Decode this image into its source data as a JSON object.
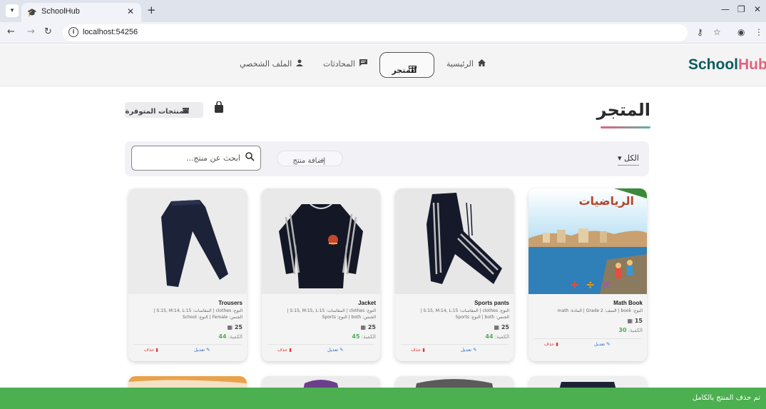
{
  "browser": {
    "tab_title": "SchoolHub",
    "url": "localhost:54256"
  },
  "header": {
    "logo_part1": "School",
    "logo_part2": "Hub",
    "nav": {
      "home": "الرئيسية",
      "store": "المتجر",
      "chats": "المحادثات",
      "profile": "الملف الشخصي"
    }
  },
  "page": {
    "title": "المتجر",
    "available_products": "المنتجات المتوفرة"
  },
  "filters": {
    "category": "الكل",
    "add_product": "إضافة منتج",
    "search_placeholder": "ابحث عن منتج..."
  },
  "labels": {
    "qty": "الكمية:",
    "edit": "تعديل",
    "delete": "حذف"
  },
  "products": [
    {
      "name": "Trousers",
      "desc_line1": "النوع: clothes | المقاسات: S:15, M:14, L:15 |",
      "desc_line2": "الجنس: Female | النوع: School",
      "price": "25",
      "qty": "44"
    },
    {
      "name": "Jacket",
      "desc_line1": "النوع: clothes | المقاسات: S:15, M:15, L:15 |",
      "desc_line2": "الجنس: both | النوع: Sports",
      "price": "25",
      "qty": "45"
    },
    {
      "name": "Sports pants",
      "desc_line1": "النوع: clothes | المقاسات: S:15, M:14, L:15 |",
      "desc_line2": "الجنس: both | النوع: Sports",
      "price": "25",
      "qty": "44"
    },
    {
      "name": "Math Book",
      "desc_line1": "النوع: book | الصف: Grade 2 | المادة: math",
      "desc_line2": "",
      "price": "15",
      "qty": "30",
      "cover_title": "الرياضيات"
    }
  ],
  "toast": "تم حذف المنتج بالكامل",
  "colors": {
    "brand_teal": "#0a5a61",
    "brand_pink": "#e2627c",
    "toast_green": "#4caf50",
    "qty_green": "#4caf50",
    "edit_blue": "#2f6fc2",
    "delete_red": "#e53935"
  }
}
